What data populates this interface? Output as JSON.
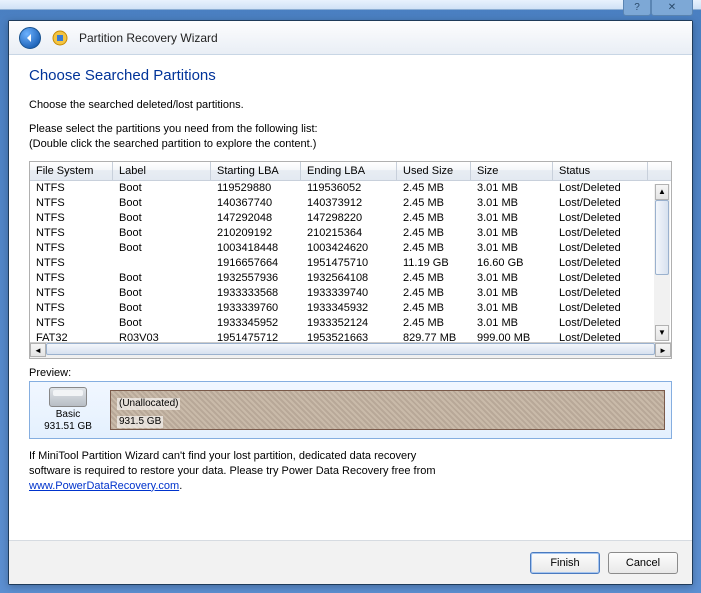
{
  "titlebar": {
    "help": "?",
    "close": "✕"
  },
  "header": {
    "title": "Partition Recovery Wizard"
  },
  "page": {
    "heading": "Choose Searched Partitions",
    "intro": "Choose the searched deleted/lost partitions.",
    "instr1": "Please select the partitions you need from the following list:",
    "instr2": "(Double click the searched partition to explore the content.)"
  },
  "table": {
    "columns": [
      "File System",
      "Label",
      "Starting LBA",
      "Ending LBA",
      "Used Size",
      "Size",
      "Status"
    ],
    "rows": [
      [
        "NTFS",
        "Boot",
        "119529880",
        "119536052",
        "2.45 MB",
        "3.01 MB",
        "Lost/Deleted"
      ],
      [
        "NTFS",
        "Boot",
        "140367740",
        "140373912",
        "2.45 MB",
        "3.01 MB",
        "Lost/Deleted"
      ],
      [
        "NTFS",
        "Boot",
        "147292048",
        "147298220",
        "2.45 MB",
        "3.01 MB",
        "Lost/Deleted"
      ],
      [
        "NTFS",
        "Boot",
        "210209192",
        "210215364",
        "2.45 MB",
        "3.01 MB",
        "Lost/Deleted"
      ],
      [
        "NTFS",
        "Boot",
        "1003418448",
        "1003424620",
        "2.45 MB",
        "3.01 MB",
        "Lost/Deleted"
      ],
      [
        "NTFS",
        "",
        "1916657664",
        "1951475710",
        "11.19 GB",
        "16.60 GB",
        "Lost/Deleted"
      ],
      [
        "NTFS",
        "Boot",
        "1932557936",
        "1932564108",
        "2.45 MB",
        "3.01 MB",
        "Lost/Deleted"
      ],
      [
        "NTFS",
        "Boot",
        "1933333568",
        "1933339740",
        "2.45 MB",
        "3.01 MB",
        "Lost/Deleted"
      ],
      [
        "NTFS",
        "Boot",
        "1933339760",
        "1933345932",
        "2.45 MB",
        "3.01 MB",
        "Lost/Deleted"
      ],
      [
        "NTFS",
        "Boot",
        "1933345952",
        "1933352124",
        "2.45 MB",
        "3.01 MB",
        "Lost/Deleted"
      ],
      [
        "FAT32",
        "R03V03",
        "1951475712",
        "1953521663",
        "829.77 MB",
        "999.00 MB",
        "Lost/Deleted"
      ]
    ]
  },
  "preview": {
    "label": "Preview:",
    "disk_type": "Basic",
    "disk_size": "931.51 GB",
    "part_label": "(Unallocated)",
    "part_size": "931.5 GB"
  },
  "note": {
    "line1": "If MiniTool Partition Wizard can't find your lost partition, dedicated data recovery",
    "line2": "software is required to restore your data. Please try Power Data Recovery free from",
    "link": "www.PowerDataRecovery.com",
    "dot": "."
  },
  "footer": {
    "finish": "Finish",
    "cancel": "Cancel"
  }
}
